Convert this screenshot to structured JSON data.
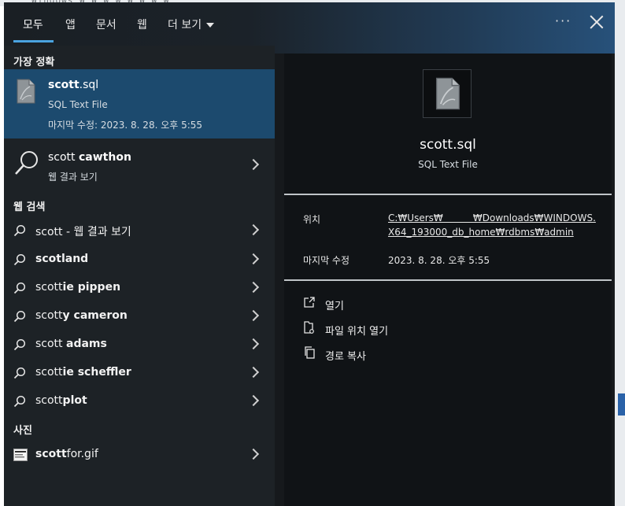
{
  "tabs": [
    "모두",
    "앱",
    "문서",
    "웹",
    "더 보기"
  ],
  "more_button": "···",
  "left": {
    "best_match_header": "가장 정확",
    "best_match": {
      "name_bold": "scott",
      "name_rest": ".sql",
      "type": "SQL Text File",
      "modified": "마지막 수정: 2023. 8. 28. 오후 5:55"
    },
    "web_top": {
      "prefix": "scott ",
      "bold": "cawthon",
      "sub": "웹 결과 보기"
    },
    "web_header": "웹 검색",
    "web_rows": [
      {
        "prefix": "scott - 웹 결과 보기",
        "bold": ""
      },
      {
        "prefix": "",
        "bold": "scotland"
      },
      {
        "prefix": "scott",
        "bold": "ie pippen"
      },
      {
        "prefix": "scott",
        "bold": "y cameron"
      },
      {
        "prefix": "scott ",
        "bold": "adams"
      },
      {
        "prefix": "scott",
        "bold": "ie scheffler"
      },
      {
        "prefix": "scott",
        "bold": "plot"
      }
    ],
    "photos_header": "사진",
    "photo_row": {
      "bold": "scott",
      "rest": "for.gif"
    }
  },
  "right": {
    "file_name": "scott.sql",
    "file_type": "SQL Text File",
    "location_label": "위치",
    "location_line1": "C:₩Users₩          ₩Downloads₩WINDOWS.",
    "location_line2": "X64_193000_db_home₩rdbms₩admin",
    "modified_label": "마지막 수정",
    "modified_value": "2023. 8. 28. 오후 5:55",
    "actions": [
      "열기",
      "파일 위치 열기",
      "경로 복사"
    ]
  },
  "colors": {
    "accent": "#4aa3e0",
    "selected": "#1c4a6e"
  }
}
